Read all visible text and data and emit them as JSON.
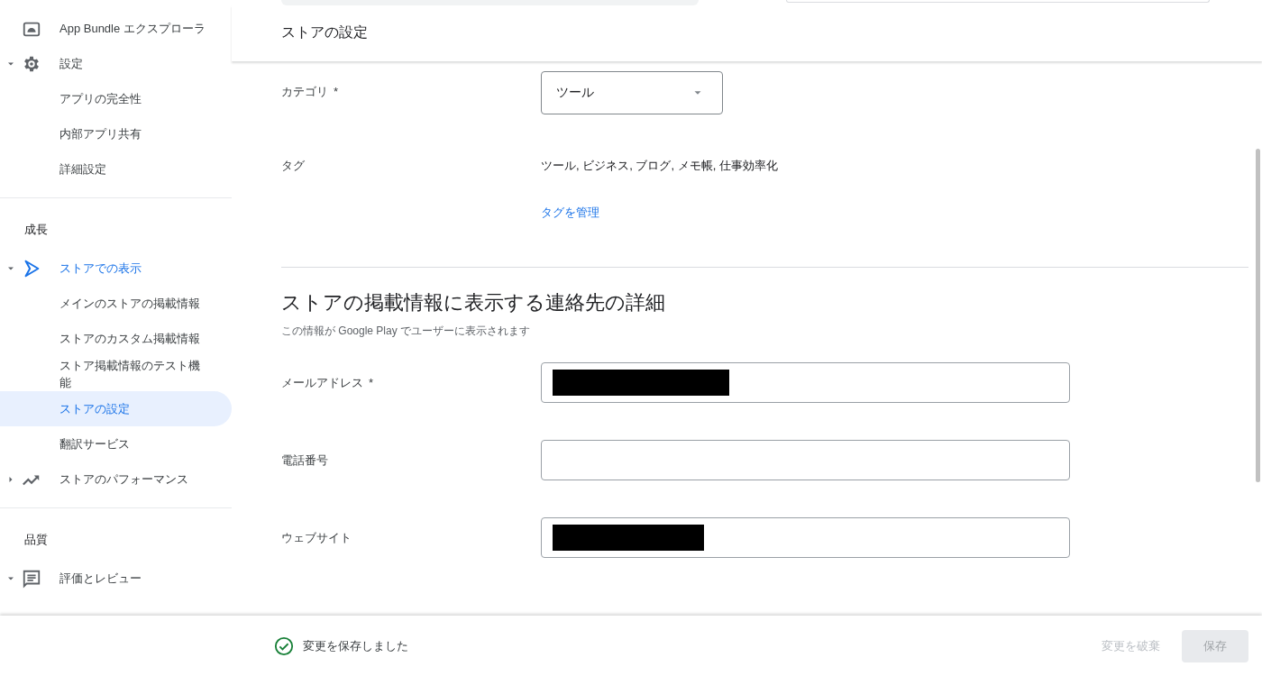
{
  "sidebar": {
    "sections": [
      {
        "items": [
          {
            "label": "App Bundle エクスプローラ",
            "selected": false
          },
          {
            "label": "設定",
            "selected": false,
            "expanded": true,
            "children": [
              {
                "label": "アプリの完全性",
                "selected": false
              },
              {
                "label": "内部アプリ共有",
                "selected": false
              },
              {
                "label": "詳細設定",
                "selected": false
              }
            ]
          }
        ]
      },
      {
        "heading": "成長",
        "items": [
          {
            "label": "ストアでの表示",
            "selected": false,
            "expanded": true,
            "children": [
              {
                "label": "メインのストアの掲載情報",
                "selected": false
              },
              {
                "label": "ストアのカスタム掲載情報",
                "selected": false
              },
              {
                "label": "ストア掲載情報のテスト機能",
                "selected": false
              },
              {
                "label": "ストアの設定",
                "selected": true
              },
              {
                "label": "翻訳サービス",
                "selected": false
              }
            ]
          },
          {
            "label": "ストアのパフォーマンス",
            "selected": false,
            "expanded": false
          }
        ]
      },
      {
        "heading": "品質",
        "items": [
          {
            "label": "評価とレビュー",
            "selected": false,
            "expanded": true
          }
        ]
      }
    ]
  },
  "store_settings": {
    "title": "ストアの設定",
    "category": {
      "label": "カテゴリ",
      "required_mark": "*",
      "value": "ツール"
    },
    "tags": {
      "label": "タグ",
      "value": "ツール, ビジネス, ブログ, メモ帳, 仕事効率化",
      "link": "タグを管理"
    }
  },
  "contact": {
    "title": "ストアの掲載情報に表示する連絡先の詳細",
    "subtitle": "この情報が Google Play でユーザーに表示されます",
    "fields": [
      {
        "label": "メールアドレス",
        "required_mark": "*",
        "redacted": true
      },
      {
        "label": "電話番号",
        "redacted": false
      },
      {
        "label": "ウェブサイト",
        "redacted": true
      }
    ]
  },
  "save_bar": {
    "status": "変更を保存しました",
    "discard": {
      "label": "変更を破棄",
      "disabled": true
    },
    "save": {
      "label": "保存",
      "disabled": true
    }
  }
}
